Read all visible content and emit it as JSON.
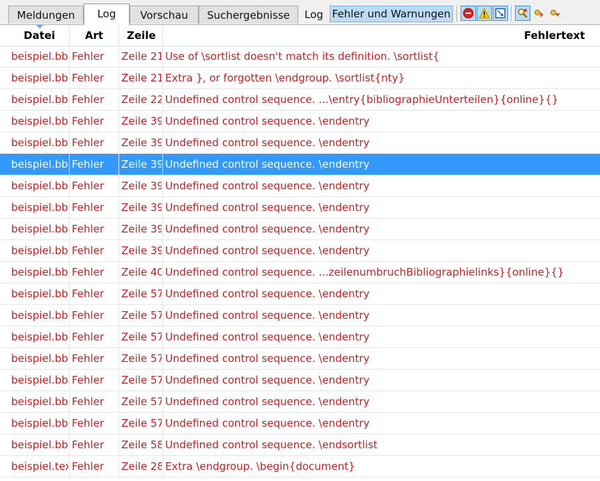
{
  "tabs": [
    {
      "label": "Meldungen",
      "active": false
    },
    {
      "label": "Log",
      "active": true
    },
    {
      "label": "Vorschau",
      "active": false
    },
    {
      "label": "Suchergebnisse",
      "active": false
    }
  ],
  "toolbar": {
    "log_label": "Log",
    "filter_button_label": "Fehler und Warnungen",
    "filter_button_active": true,
    "tools": [
      {
        "name": "show-errors-icon",
        "toggled": true
      },
      {
        "name": "show-warnings-icon",
        "toggled": true
      },
      {
        "name": "show-badboxes-icon",
        "toggled": true
      },
      {
        "name": "search-log-icon",
        "toggled": true
      },
      {
        "name": "previous-entry-icon",
        "toggled": false
      },
      {
        "name": "next-entry-icon",
        "toggled": false
      }
    ]
  },
  "table": {
    "columns": [
      "Datei",
      "Art",
      "Zeile",
      "Fehlertext"
    ],
    "sort_column": "Datei",
    "selected_row_index": 5,
    "rows": [
      {
        "file": "beispiel.bbl",
        "type": "Fehler",
        "line": "Zeile 21",
        "text": "Use of \\sortlist doesn't match its definition. \\sortlist{"
      },
      {
        "file": "beispiel.bbl",
        "type": "Fehler",
        "line": "Zeile 21",
        "text": "Extra }, or forgotten \\endgroup. \\sortlist{nty}"
      },
      {
        "file": "beispiel.bbl",
        "type": "Fehler",
        "line": "Zeile 22",
        "text": "Undefined control sequence. ...\\entry{bibliographieUnterteilen}{online}{}"
      },
      {
        "file": "beispiel.bbl",
        "type": "Fehler",
        "line": "Zeile 39",
        "text": "Undefined control sequence. \\endentry"
      },
      {
        "file": "beispiel.bbl",
        "type": "Fehler",
        "line": "Zeile 39",
        "text": "Undefined control sequence. \\endentry"
      },
      {
        "file": "beispiel.bbl",
        "type": "Fehler",
        "line": "Zeile 39",
        "text": "Undefined control sequence. \\endentry"
      },
      {
        "file": "beispiel.bbl",
        "type": "Fehler",
        "line": "Zeile 39",
        "text": "Undefined control sequence. \\endentry"
      },
      {
        "file": "beispiel.bbl",
        "type": "Fehler",
        "line": "Zeile 39",
        "text": "Undefined control sequence. \\endentry"
      },
      {
        "file": "beispiel.bbl",
        "type": "Fehler",
        "line": "Zeile 39",
        "text": "Undefined control sequence. \\endentry"
      },
      {
        "file": "beispiel.bbl",
        "type": "Fehler",
        "line": "Zeile 39",
        "text": "Undefined control sequence. \\endentry"
      },
      {
        "file": "beispiel.bbl",
        "type": "Fehler",
        "line": "Zeile 40",
        "text": "Undefined control sequence. ...zeilenumbruchBibliographielinks}{online}{}"
      },
      {
        "file": "beispiel.bbl",
        "type": "Fehler",
        "line": "Zeile 57",
        "text": "Undefined control sequence. \\endentry"
      },
      {
        "file": "beispiel.bbl",
        "type": "Fehler",
        "line": "Zeile 57",
        "text": "Undefined control sequence. \\endentry"
      },
      {
        "file": "beispiel.bbl",
        "type": "Fehler",
        "line": "Zeile 57",
        "text": "Undefined control sequence. \\endentry"
      },
      {
        "file": "beispiel.bbl",
        "type": "Fehler",
        "line": "Zeile 57",
        "text": "Undefined control sequence. \\endentry"
      },
      {
        "file": "beispiel.bbl",
        "type": "Fehler",
        "line": "Zeile 57",
        "text": "Undefined control sequence. \\endentry"
      },
      {
        "file": "beispiel.bbl",
        "type": "Fehler",
        "line": "Zeile 57",
        "text": "Undefined control sequence. \\endentry"
      },
      {
        "file": "beispiel.bbl",
        "type": "Fehler",
        "line": "Zeile 57",
        "text": "Undefined control sequence. \\endentry"
      },
      {
        "file": "beispiel.bbl",
        "type": "Fehler",
        "line": "Zeile 58",
        "text": "Undefined control sequence. \\endsortlist"
      },
      {
        "file": "beispiel.tex",
        "type": "Fehler",
        "line": "Zeile 28",
        "text": "Extra \\endgroup. \\begin{document}"
      }
    ]
  },
  "colors": {
    "error_text": "#cc2020",
    "selection": "#3399ff",
    "toggle_bg": "#bcdcf4"
  }
}
